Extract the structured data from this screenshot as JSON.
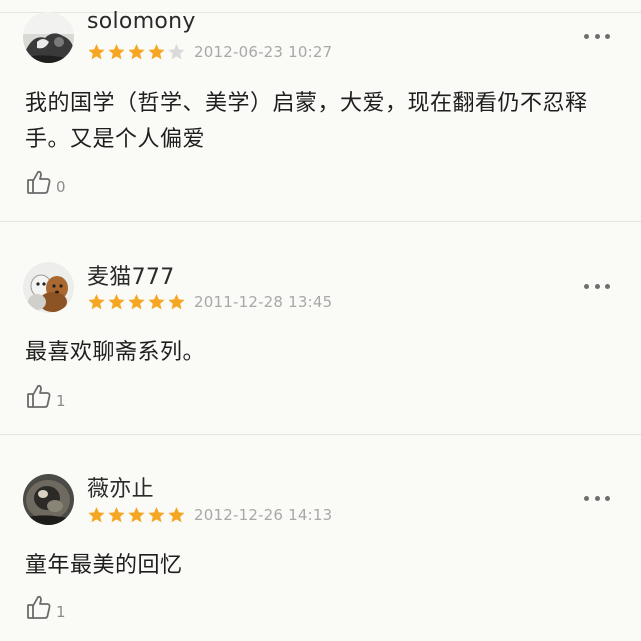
{
  "colors": {
    "star_filled": "#f5a623",
    "star_empty": "#dadada",
    "timestamp": "#a8a8a8",
    "background": "#fafaf7"
  },
  "reviews": [
    {
      "username": "solomony",
      "rating": 4,
      "max_rating": 5,
      "timestamp": "2012-06-23 10:27",
      "content": "我的国学（哲学、美学）启蒙，大爱，现在翻看仍不忍释手。又是个人偏爱",
      "likes": "0",
      "like_icon": "thumbs-up-icon",
      "more_icon": "more-dots-icon"
    },
    {
      "username": "麦猫777",
      "rating": 5,
      "max_rating": 5,
      "timestamp": "2011-12-28 13:45",
      "content": "最喜欢聊斋系列。",
      "likes": "1",
      "like_icon": "thumbs-up-icon",
      "more_icon": "more-dots-icon"
    },
    {
      "username": "薇亦止",
      "rating": 5,
      "max_rating": 5,
      "timestamp": "2012-12-26 14:13",
      "content": "童年最美的回忆",
      "likes": "1",
      "like_icon": "thumbs-up-icon",
      "more_icon": "more-dots-icon"
    }
  ]
}
